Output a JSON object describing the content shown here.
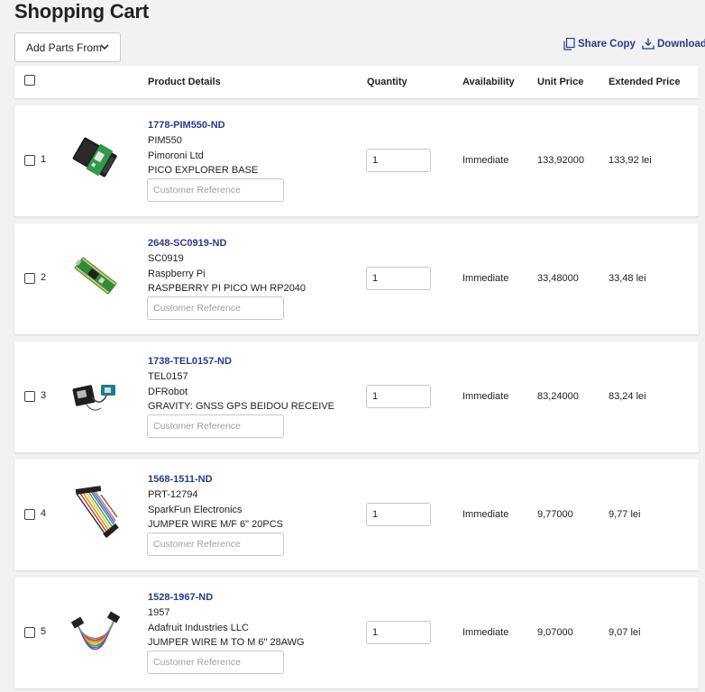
{
  "page": {
    "title": "Shopping Cart"
  },
  "toolbar": {
    "add_parts_label": "Add Parts From",
    "share_copy_label": "Share Copy",
    "download_label": "Download"
  },
  "table": {
    "headers": {
      "product_details": "Product Details",
      "quantity": "Quantity",
      "availability": "Availability",
      "unit_price": "Unit Price",
      "extended_price": "Extended Price"
    },
    "customer_reference_placeholder": "Customer Reference",
    "rows": [
      {
        "index": "1",
        "part_number": "1778-PIM550-ND",
        "mfr_part": "PIM550",
        "manufacturer": "Pimoroni Ltd",
        "description": "PICO EXPLORER BASE",
        "quantity": "1",
        "availability": "Immediate",
        "unit_price": "133,92000",
        "extended_price": "133,92 lei",
        "image_icon": "pico-explorer-board-icon"
      },
      {
        "index": "2",
        "part_number": "2648-SC0919-ND",
        "mfr_part": "SC0919",
        "manufacturer": "Raspberry Pi",
        "description": "RASPBERRY PI PICO WH RP2040",
        "quantity": "1",
        "availability": "Immediate",
        "unit_price": "33,48000",
        "extended_price": "33,48 lei",
        "image_icon": "raspberry-pi-pico-icon"
      },
      {
        "index": "3",
        "part_number": "1738-TEL0157-ND",
        "mfr_part": "TEL0157",
        "manufacturer": "DFRobot",
        "description": "GRAVITY: GNSS GPS BEIDOU RECEIVE",
        "quantity": "1",
        "availability": "Immediate",
        "unit_price": "83,24000",
        "extended_price": "83,24 lei",
        "image_icon": "gnss-module-icon"
      },
      {
        "index": "4",
        "part_number": "1568-1511-ND",
        "mfr_part": "PRT-12794",
        "manufacturer": "SparkFun Electronics",
        "description": "JUMPER WIRE M/F 6\" 20PCS",
        "quantity": "1",
        "availability": "Immediate",
        "unit_price": "9,77000",
        "extended_price": "9,77 lei",
        "image_icon": "jumper-wires-icon"
      },
      {
        "index": "5",
        "part_number": "1528-1967-ND",
        "mfr_part": "1957",
        "manufacturer": "Adafruit Industries LLC",
        "description": "JUMPER WIRE M TO M 6\" 28AWG",
        "quantity": "1",
        "availability": "Immediate",
        "unit_price": "9,07000",
        "extended_price": "9,07 lei",
        "image_icon": "ribbon-jumper-wires-icon"
      }
    ]
  },
  "colors": {
    "link": "#2a3a8c",
    "background": "#f2f2f2",
    "card": "#ffffff"
  }
}
